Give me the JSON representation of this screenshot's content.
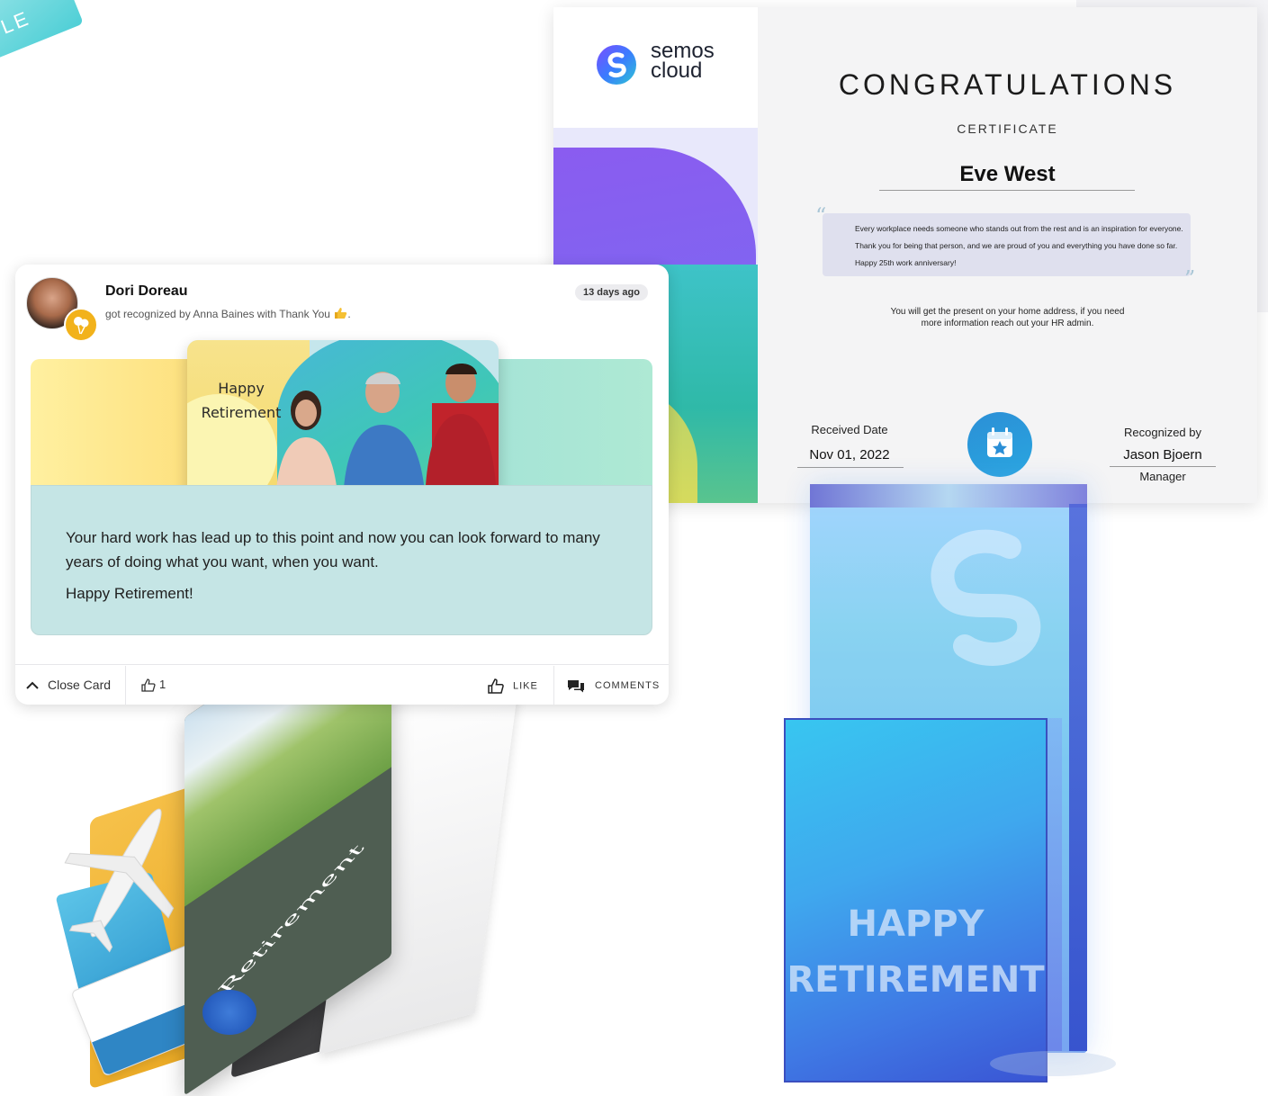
{
  "ribbon": {
    "text": "LE"
  },
  "certificate": {
    "brand": "semos\ncloud",
    "title": "CONGRATULATIONS",
    "subtitle": "CERTIFICATE",
    "recipient": "Eve West",
    "quote": "Every workplace needs someone who stands out from the rest and is an inspiration for everyone. Thank you for being that person, and we are proud of you and everything you have done so far. Happy 25th work anniversary!",
    "present_note": "You will get the present on your home address, if you need more information reach out your HR admin.",
    "received_date_label": "Received Date",
    "received_date": "Nov 01, 2022",
    "recognized_by_label": "Recognized by",
    "recognized_by": "Jason Bjoern",
    "recognized_by_role": "Manager",
    "colors": {
      "accent": "#2b8fd6",
      "purple": "#8a5cf0",
      "teal": "#3ec3c8"
    }
  },
  "feed_card": {
    "poster_name": "Dori Doreau",
    "poster_sub": "got recognized by Anna Baines with Thank You",
    "time_ago": "13 days ago",
    "card_title": "Happy\nRetirement",
    "message_p1": "Your hard work has lead up to this point and now you can look forward to many years of doing what you want, when you want.",
    "message_p2": "Happy Retirement!",
    "close_label": "Close Card",
    "like_count": "1",
    "like_label": "LIKE",
    "comments_label": "COMMENTS"
  },
  "printed_card": {
    "title": "Retirement"
  },
  "trophy": {
    "text_line1": "HAPPY",
    "text_line2": "RETIREMENT"
  }
}
